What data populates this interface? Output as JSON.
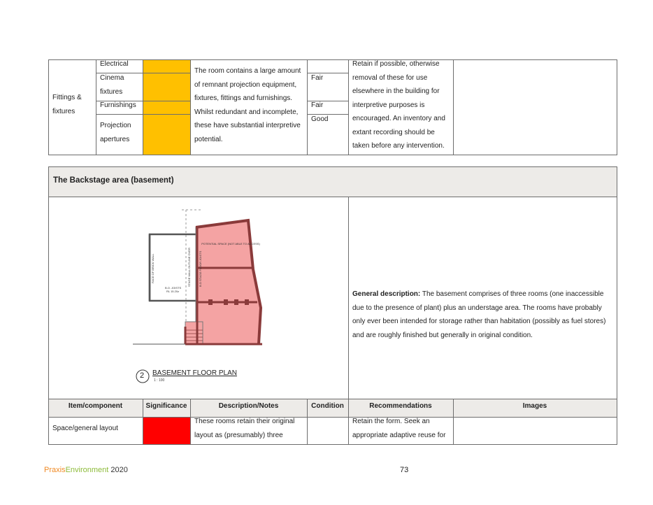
{
  "colors": {
    "amber": "#FFC000",
    "red": "#FF0000",
    "header_bg": "#EDEBE8",
    "brand_praxis": "#F08A24",
    "brand_env": "#8DBB3A"
  },
  "fittings": {
    "item": "Fittings & fixtures",
    "components": [
      "Electrical",
      "Cinema fixtures",
      "Furnishings",
      "Projection apertures"
    ],
    "description": "The room contains a large amount of remnant projection equipment, fixtures, fittings and furnishings. Whilst redundant and incomplete, these have substantial interpretive potential.",
    "conditions": [
      "",
      "Fair",
      "Fair",
      "Good"
    ],
    "recommendation": "Retain if possible, otherwise removal of these for use elsewhere in the building for interpretive purposes is encouraged.  An inventory and extant recording should be taken before any intervention."
  },
  "backstage": {
    "title": "The Backstage area (basement)",
    "plan_title": "BASEMENT FLOOR PLAN",
    "plan_number": "2",
    "plan_scale": "1 : 100",
    "plan_labels": [
      "POTENTIAL SPACE (NOT ABLE TO ACCESS AT TIME OF SURVEY)",
      "STAGE WALL OUTLINE OVER",
      "B.O STAGE FLOOR JOISTS",
      "FACE OF BRICK WALL",
      "B.O. JOISTS RL 15.20z"
    ],
    "general_label": "General description:",
    "general_text": " The basement comprises of three rooms (one inaccessible due to the presence of plant) plus an understage area. The rooms have probably only ever been intended for storage rather than habitation (possibly as fuel stores) and are roughly finished but generally in original condition."
  },
  "table_headers": [
    "Item/component",
    "Significance",
    "Description/Notes",
    "Condition",
    "Recommendations",
    "Images"
  ],
  "row": {
    "item": "Space/general layout",
    "description": "These rooms retain their original layout as (presumably) three",
    "recommendation": "Retain the form.  Seek an appropriate adaptive reuse for"
  },
  "footer": {
    "praxis": "Praxis",
    "environment": "Environment",
    "year": " 2020",
    "page": "73"
  }
}
